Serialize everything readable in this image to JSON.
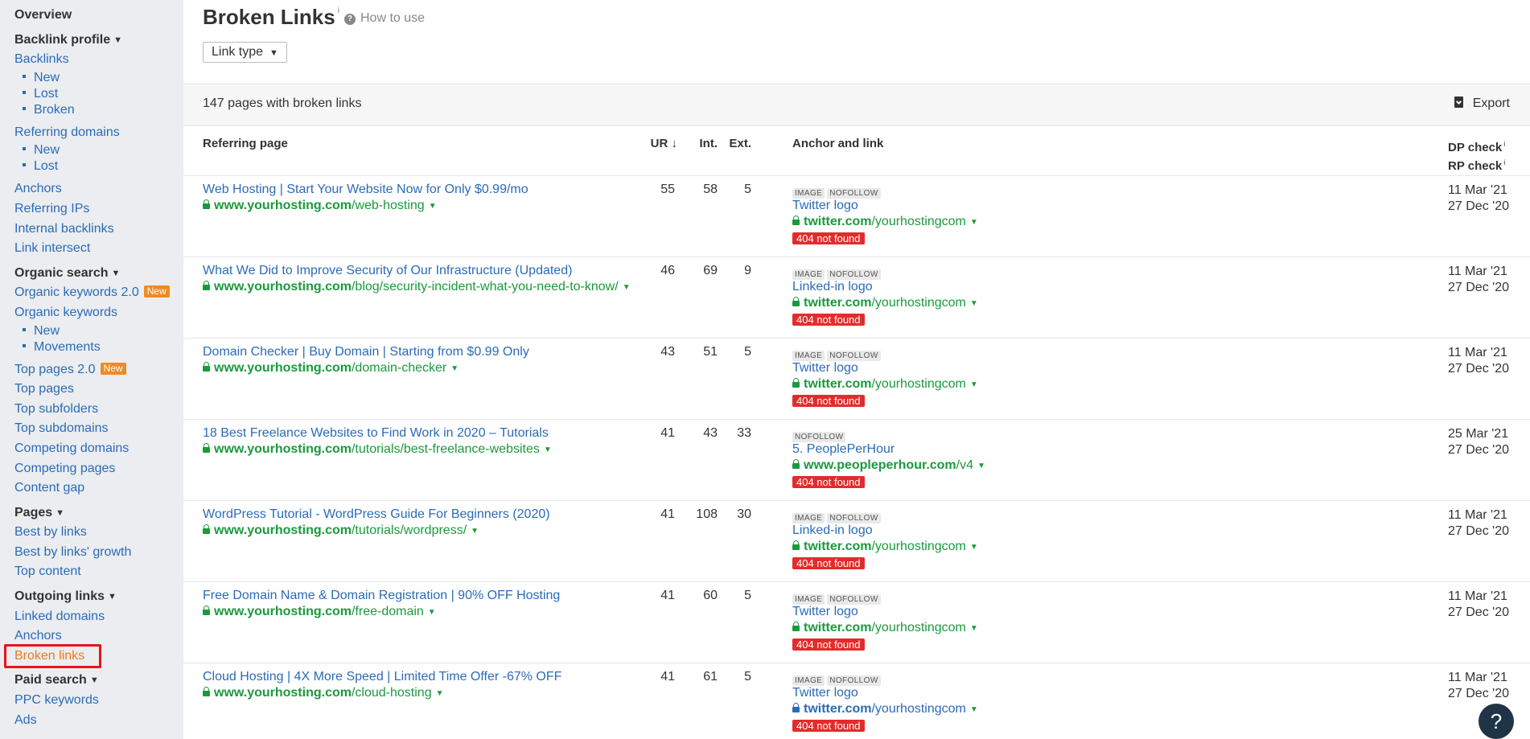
{
  "sidebar": {
    "entries": [
      {
        "type": "section",
        "label": "Overview",
        "caret": false
      },
      {
        "type": "section",
        "label": "Backlink profile",
        "caret": true
      },
      {
        "type": "link",
        "label": "Backlinks"
      },
      {
        "type": "sub",
        "label": "New"
      },
      {
        "type": "sub",
        "label": "Lost"
      },
      {
        "type": "sub",
        "label": "Broken"
      },
      {
        "type": "link",
        "label": "Referring domains",
        "gap": true
      },
      {
        "type": "sub",
        "label": "New"
      },
      {
        "type": "sub",
        "label": "Lost"
      },
      {
        "type": "link",
        "label": "Anchors",
        "gap": true
      },
      {
        "type": "link",
        "label": "Referring IPs"
      },
      {
        "type": "link",
        "label": "Internal backlinks"
      },
      {
        "type": "link",
        "label": "Link intersect"
      },
      {
        "type": "section",
        "label": "Organic search",
        "caret": true
      },
      {
        "type": "link",
        "label": "Organic keywords 2.0",
        "badge": "New"
      },
      {
        "type": "link",
        "label": "Organic keywords"
      },
      {
        "type": "sub",
        "label": "New"
      },
      {
        "type": "sub",
        "label": "Movements"
      },
      {
        "type": "link",
        "label": "Top pages 2.0",
        "badge": "New",
        "gap": true
      },
      {
        "type": "link",
        "label": "Top pages"
      },
      {
        "type": "link",
        "label": "Top subfolders"
      },
      {
        "type": "link",
        "label": "Top subdomains"
      },
      {
        "type": "link",
        "label": "Competing domains"
      },
      {
        "type": "link",
        "label": "Competing pages"
      },
      {
        "type": "link",
        "label": "Content gap"
      },
      {
        "type": "section",
        "label": "Pages",
        "caret": true
      },
      {
        "type": "link",
        "label": "Best by links"
      },
      {
        "type": "link",
        "label": "Best by links' growth"
      },
      {
        "type": "link",
        "label": "Top content"
      },
      {
        "type": "section",
        "label": "Outgoing links",
        "caret": true
      },
      {
        "type": "link",
        "label": "Linked domains"
      },
      {
        "type": "link",
        "label": "Anchors"
      },
      {
        "type": "link",
        "label": "Broken links",
        "active": true
      },
      {
        "type": "section",
        "label": "Paid search",
        "caret": true
      },
      {
        "type": "link",
        "label": "PPC keywords"
      },
      {
        "type": "link",
        "label": "Ads"
      }
    ]
  },
  "header": {
    "title": "Broken Links",
    "info_mark": "i",
    "how_to_use": "How to use",
    "link_type_label": "Link type"
  },
  "summary": {
    "text": "147 pages with broken links",
    "export_label": "Export"
  },
  "table": {
    "columns": {
      "referring_page": "Referring page",
      "ur": "UR",
      "ur_sort": "↓",
      "int": "Int.",
      "ext": "Ext.",
      "anchor": "Anchor and link",
      "dp_check": "DP check",
      "rp_check": "RP check"
    },
    "rows": [
      {
        "title": "Web Hosting | Start Your Website Now for Only $0.99/mo",
        "domain": "www.yourhosting.com",
        "path": "/web-hosting",
        "ur": "55",
        "int": "58",
        "ext": "5",
        "tags": [
          "IMAGE",
          "NOFOLLOW"
        ],
        "anchor_text": "Twitter logo",
        "anchor_domain": "twitter.com",
        "anchor_path": "/yourhostingcom",
        "error": "404 not found",
        "dp": "11 Mar '21",
        "rp": "27 Dec '20"
      },
      {
        "title": "What We Did to Improve Security of Our Infrastructure (Updated)",
        "domain": "www.yourhosting.com",
        "path": "/blog/security-incident-what-you-need-to-know/",
        "ur": "46",
        "int": "69",
        "ext": "9",
        "tags": [
          "IMAGE",
          "NOFOLLOW"
        ],
        "anchor_text": "Linked-in logo",
        "anchor_domain": "twitter.com",
        "anchor_path": "/yourhostingcom",
        "error": "404 not found",
        "dp": "11 Mar '21",
        "rp": "27 Dec '20"
      },
      {
        "title": "Domain Checker | Buy Domain | Starting from $0.99 Only",
        "domain": "www.yourhosting.com",
        "path": "/domain-checker",
        "ur": "43",
        "int": "51",
        "ext": "5",
        "tags": [
          "IMAGE",
          "NOFOLLOW"
        ],
        "anchor_text": "Twitter logo",
        "anchor_domain": "twitter.com",
        "anchor_path": "/yourhostingcom",
        "error": "404 not found",
        "dp": "11 Mar '21",
        "rp": "27 Dec '20"
      },
      {
        "title": "18 Best Freelance Websites to Find Work in 2020 – Tutorials",
        "domain": "www.yourhosting.com",
        "path": "/tutorials/best-freelance-websites",
        "ur": "41",
        "int": "43",
        "ext": "33",
        "tags": [
          "NOFOLLOW"
        ],
        "anchor_text": "5. PeoplePerHour",
        "anchor_domain": "www.peopleperhour.com",
        "anchor_path": "/v4",
        "error": "404 not found",
        "dp": "25 Mar '21",
        "rp": "27 Dec '20"
      },
      {
        "title": "WordPress Tutorial - WordPress Guide For Beginners (2020)",
        "domain": "www.yourhosting.com",
        "path": "/tutorials/wordpress/",
        "ur": "41",
        "int": "108",
        "ext": "30",
        "tags": [
          "IMAGE",
          "NOFOLLOW"
        ],
        "anchor_text": "Linked-in logo",
        "anchor_domain": "twitter.com",
        "anchor_path": "/yourhostingcom",
        "error": "404 not found",
        "dp": "11 Mar '21",
        "rp": "27 Dec '20"
      },
      {
        "title": "Free Domain Name & Domain Registration | 90% OFF Hosting",
        "domain": "www.yourhosting.com",
        "path": "/free-domain",
        "ur": "41",
        "int": "60",
        "ext": "5",
        "tags": [
          "IMAGE",
          "NOFOLLOW"
        ],
        "anchor_text": "Twitter logo",
        "anchor_domain": "twitter.com",
        "anchor_path": "/yourhostingcom",
        "error": "404 not found",
        "dp": "11 Mar '21",
        "rp": "27 Dec '20"
      },
      {
        "title": "Cloud Hosting | 4X More Speed | Limited Time Offer -67% OFF",
        "domain": "www.yourhosting.com",
        "path": "/cloud-hosting",
        "ur": "41",
        "int": "61",
        "ext": "5",
        "tags": [
          "IMAGE",
          "NOFOLLOW"
        ],
        "anchor_text": "Twitter logo",
        "anchor_domain": "twitter.com",
        "anchor_path": "/yourhostingcom",
        "anchor_url_blue": true,
        "error": "404 not found",
        "dp": "11 Mar '21",
        "rp": "27 Dec '20"
      }
    ]
  },
  "help_button": "?",
  "colors": {
    "link": "#2b6bb8",
    "url_green": "#1a9a3c",
    "error_red": "#e22c2c",
    "active_orange": "#ee7b1d",
    "badge_orange": "#f08a24",
    "highlight_box": "#e8141a"
  }
}
